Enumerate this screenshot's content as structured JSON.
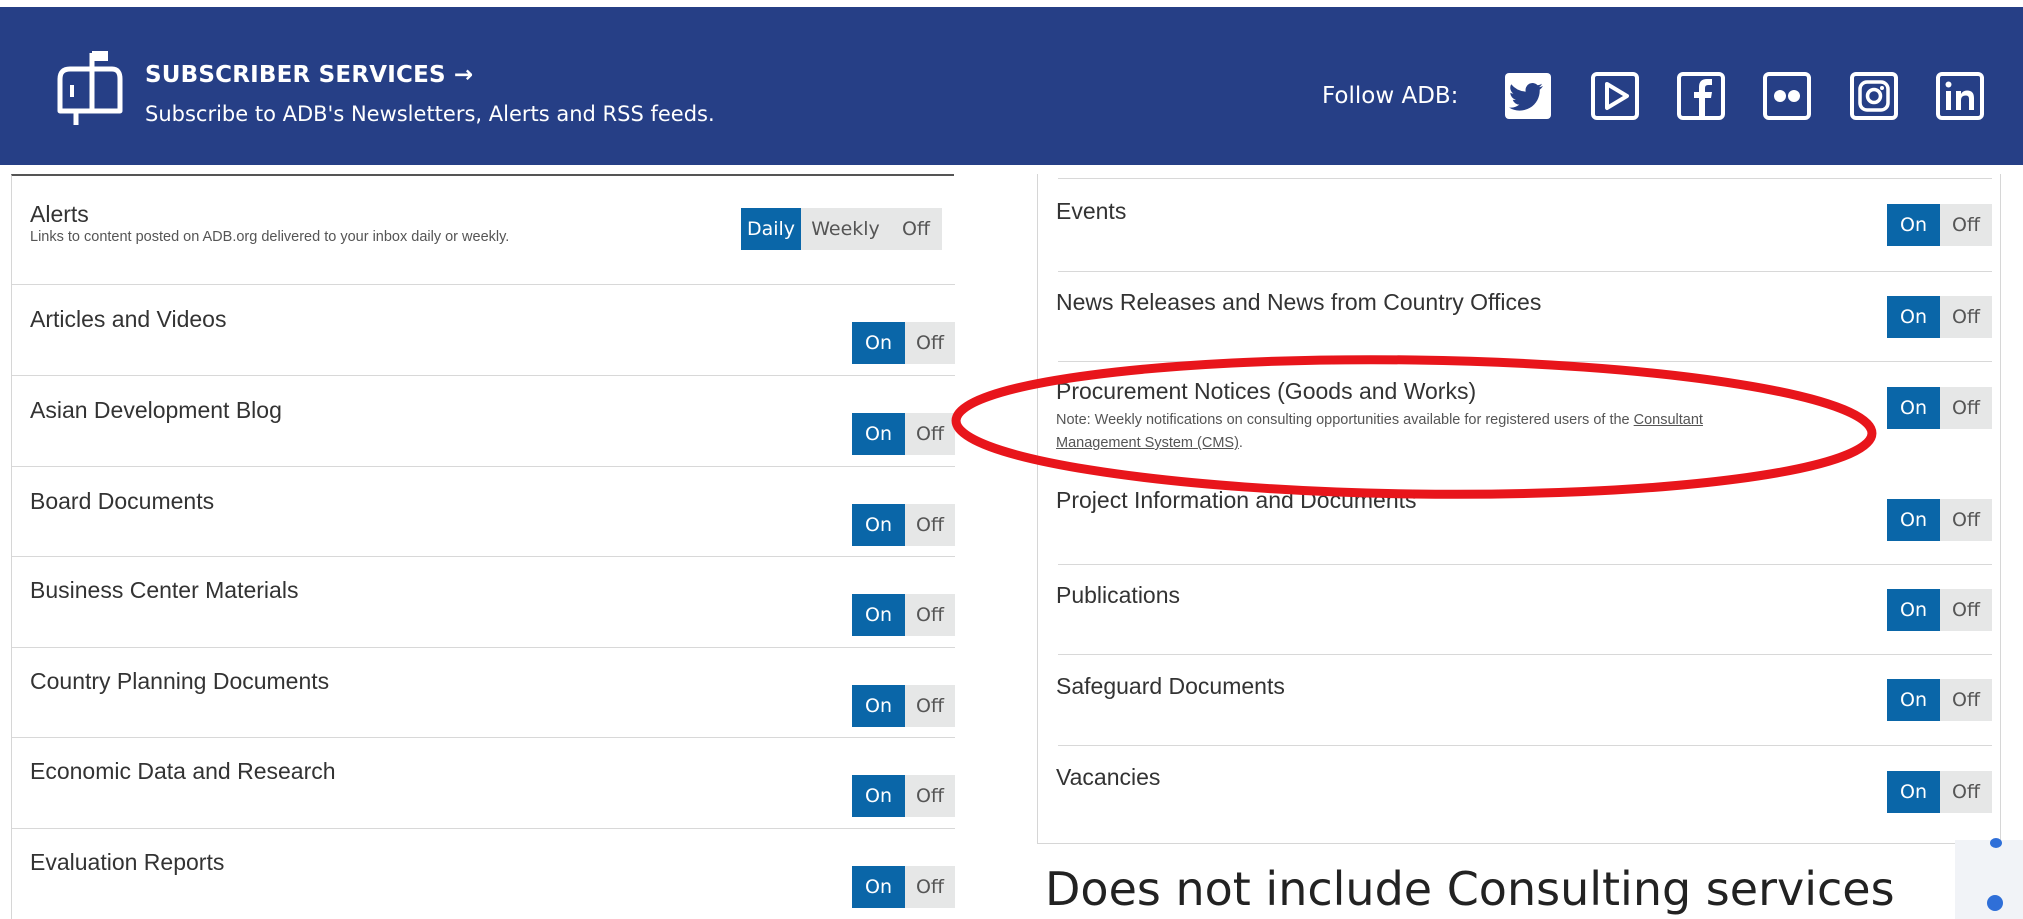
{
  "header": {
    "title": "SUBSCRIBER SERVICES →",
    "description": "Subscribe to ADB's Newsletters, Alerts and RSS feeds.",
    "follow_label": "Follow ADB:",
    "social_icons": [
      "twitter-icon",
      "youtube-icon",
      "facebook-icon",
      "flickr-icon",
      "instagram-icon",
      "linkedin-icon"
    ],
    "bg_color": "#263f86"
  },
  "colors": {
    "toggle_active": "#0a66a8",
    "toggle_inactive": "#e6e7e7",
    "annotation": "#e8151b"
  },
  "left_list": {
    "alerts": {
      "title": "Alerts",
      "subtitle": "Links to content posted on ADB.org delivered to your inbox daily or weekly.",
      "options": [
        "Daily",
        "Weekly",
        "Off"
      ],
      "selected": "Daily"
    },
    "items": [
      {
        "title": "Articles and Videos",
        "on": "On",
        "off": "Off"
      },
      {
        "title": "Asian Development Blog",
        "on": "On",
        "off": "Off"
      },
      {
        "title": "Board Documents",
        "on": "On",
        "off": "Off"
      },
      {
        "title": "Business Center Materials",
        "on": "On",
        "off": "Off"
      },
      {
        "title": "Country Planning Documents",
        "on": "On",
        "off": "Off"
      },
      {
        "title": "Economic Data and Research",
        "on": "On",
        "off": "Off"
      },
      {
        "title": "Evaluation Reports",
        "on": "On",
        "off": "Off"
      }
    ]
  },
  "right_list": {
    "items": [
      {
        "title": "Events",
        "on": "On",
        "off": "Off"
      },
      {
        "title": "News Releases and News from Country Offices",
        "on": "On",
        "off": "Off"
      },
      {
        "title": "Procurement Notices (Goods and Works)",
        "note_prefix": "Note: Weekly notifications on consulting opportunities available for registered users of the ",
        "note_link_1": "Consultant",
        "note_link_2": "Management System (CMS)",
        "note_suffix": ".",
        "on": "On",
        "off": "Off"
      },
      {
        "title": "Project Information and Documents",
        "on": "On",
        "off": "Off"
      },
      {
        "title": "Publications",
        "on": "On",
        "off": "Off"
      },
      {
        "title": "Safeguard Documents",
        "on": "On",
        "off": "Off"
      },
      {
        "title": "Vacancies",
        "on": "On",
        "off": "Off"
      }
    ]
  },
  "annotation": {
    "text": "Does not include Consulting services"
  }
}
